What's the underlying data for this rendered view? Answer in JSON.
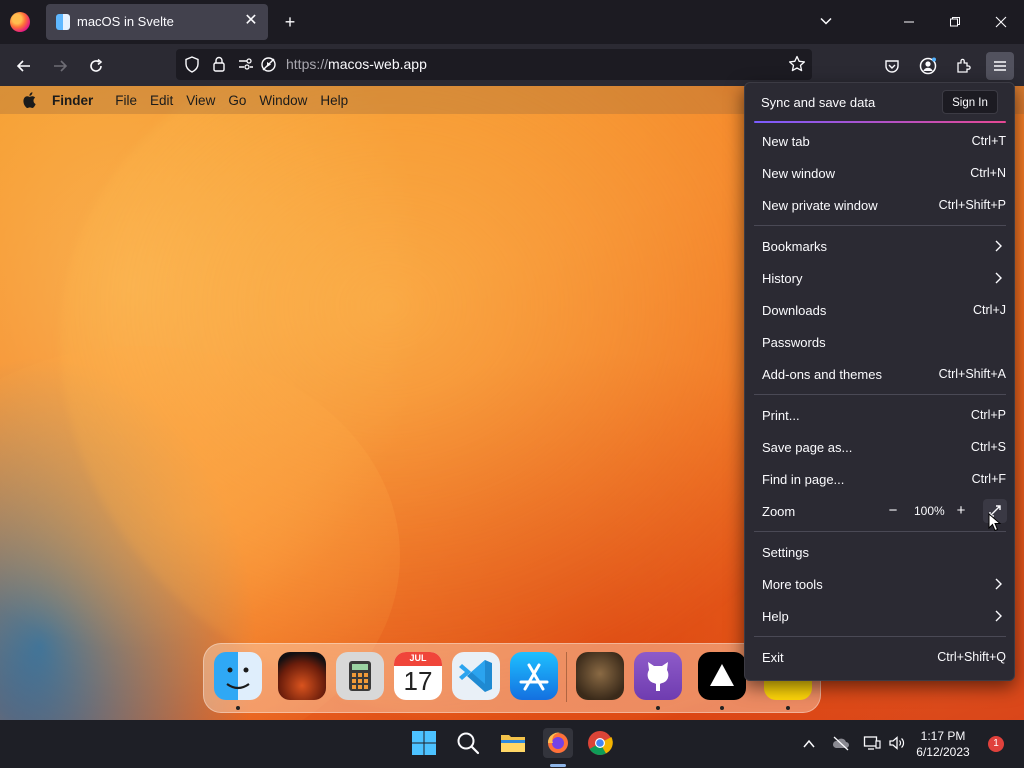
{
  "browser": {
    "tab": {
      "title": "macOS in Svelte",
      "close_glyph": "✕"
    },
    "new_tab_glyph": "+",
    "url": {
      "protocol": "https://",
      "host": "macos-web.app"
    }
  },
  "macos": {
    "menubar": [
      "File",
      "Edit",
      "View",
      "Go",
      "Window",
      "Help"
    ],
    "app_name": "Finder",
    "dock": {
      "calendar_month": "JUL",
      "calendar_day": "17",
      "apps": [
        "Finder",
        "Launchpad",
        "Calculator",
        "Calendar",
        "VS Code",
        "App Store",
        "Cat app",
        "GitHub",
        "Vercel",
        "Notes"
      ]
    }
  },
  "app_menu": {
    "sync_label": "Sync and save data",
    "sign_in": "Sign In",
    "items": [
      {
        "label": "New tab",
        "shortcut": "Ctrl+T"
      },
      {
        "label": "New window",
        "shortcut": "Ctrl+N"
      },
      {
        "label": "New private window",
        "shortcut": "Ctrl+Shift+P"
      },
      {
        "label": "Bookmarks",
        "shortcut": ""
      },
      {
        "label": "History",
        "shortcut": ""
      },
      {
        "label": "Downloads",
        "shortcut": "Ctrl+J"
      },
      {
        "label": "Passwords",
        "shortcut": ""
      },
      {
        "label": "Add-ons and themes",
        "shortcut": "Ctrl+Shift+A"
      },
      {
        "label": "Print...",
        "shortcut": "Ctrl+P"
      },
      {
        "label": "Save page as...",
        "shortcut": "Ctrl+S"
      },
      {
        "label": "Find in page...",
        "shortcut": "Ctrl+F"
      },
      {
        "label": "Zoom",
        "shortcut": ""
      },
      {
        "label": "Settings",
        "shortcut": ""
      },
      {
        "label": "More tools",
        "shortcut": ""
      },
      {
        "label": "Help",
        "shortcut": ""
      },
      {
        "label": "Exit",
        "shortcut": "Ctrl+Shift+Q"
      }
    ],
    "zoom": {
      "minus": "−",
      "value": "100%",
      "plus": "+"
    }
  },
  "taskbar": {
    "time": "1:17 PM",
    "date": "6/12/2023",
    "notification_count": "1"
  },
  "colors": {
    "browser_bg": "#1c1b22",
    "toolbar_bg": "#2b2a33",
    "menu_bg": "#2b2a33",
    "accent_gradient_start": "#7a5cff",
    "accent_gradient_end": "#e64893",
    "taskbar_bg": "#1e1f26"
  }
}
